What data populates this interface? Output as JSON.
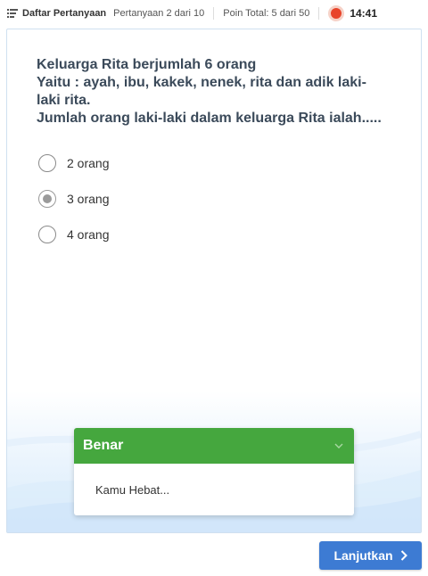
{
  "topbar": {
    "question_list_label": "Daftar Pertanyaan",
    "question_index": "Pertanyaan 2 dari 10",
    "points": "Poin Total: 5 dari 50",
    "timer": "14:41"
  },
  "question": {
    "lines": [
      "Keluarga Rita berjumlah 6 orang",
      "Yaitu : ayah, ibu, kakek, nenek, rita dan adik laki-",
      "laki rita.",
      "Jumlah orang laki-laki dalam keluarga Rita ialah....."
    ]
  },
  "options": [
    {
      "label": "2 orang",
      "selected": false
    },
    {
      "label": "3 orang",
      "selected": true
    },
    {
      "label": "4 orang",
      "selected": false
    }
  ],
  "feedback": {
    "title": "Benar",
    "message": "Kamu Hebat...",
    "header_color": "#45a73e"
  },
  "next_button": {
    "label": "Lanjutkan"
  },
  "icons": {
    "list": "list-icon",
    "timer": "timer-dot-icon",
    "feedback_toggle": "chevron-down-icon",
    "next": "chevron-right-icon"
  }
}
